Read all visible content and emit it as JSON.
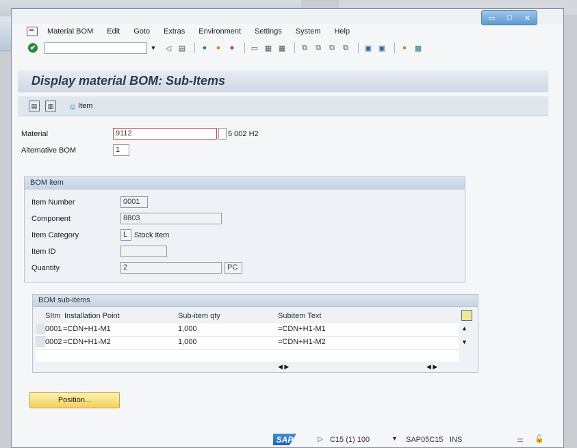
{
  "menubar": {
    "items": [
      {
        "label": "Material BOM",
        "ul": "M"
      },
      {
        "label": "Edit",
        "ul": "E"
      },
      {
        "label": "Goto",
        "ul": "G"
      },
      {
        "label": "Extras",
        "ul": "a"
      },
      {
        "label": "Environment",
        "ul": "v"
      },
      {
        "label": "Settings",
        "ul": "S"
      },
      {
        "label": "System",
        "ul": "y"
      },
      {
        "label": "Help",
        "ul": "H"
      }
    ]
  },
  "window_buttons": {
    "min": "▭",
    "max": "□",
    "close": "✕"
  },
  "page": {
    "title": "Display material BOM: Sub-Items"
  },
  "apptoolbar": {
    "item_label": "Item"
  },
  "header": {
    "material_label": "Material",
    "material_value": "9112",
    "material_desc": "5 002 H2",
    "altbom_label": "Alternative BOM",
    "altbom_value": "1"
  },
  "bom_item": {
    "title": "BOM item",
    "item_number_label": "Item Number",
    "item_number_value": "0001",
    "component_label": "Component",
    "component_value": "8803",
    "item_category_label": "Item Category",
    "item_category_value": "L",
    "item_category_desc": "Stock item",
    "item_id_label": "Item ID",
    "item_id_value": "",
    "quantity_label": "Quantity",
    "quantity_value": "2",
    "quantity_unit": "PC"
  },
  "subitems": {
    "title": "BOM sub-items",
    "columns": {
      "sitm": "SItm",
      "install_point": "Installation Point",
      "qty": "Sub-item qty",
      "text": "Subitem Text"
    },
    "rows": [
      {
        "sitm": "0001",
        "install_point": "=CDN+H1-M1",
        "qty": "1,000",
        "text": "=CDN+H1-M1"
      },
      {
        "sitm": "0002",
        "install_point": "=CDN+H1-M2",
        "qty": "1,000",
        "text": "=CDN+H1-M2"
      }
    ]
  },
  "buttons": {
    "position": "Position..."
  },
  "status": {
    "logo": "SAP",
    "system": "C15 (1) 100",
    "server": "SAP05C15",
    "mode": "INS"
  }
}
